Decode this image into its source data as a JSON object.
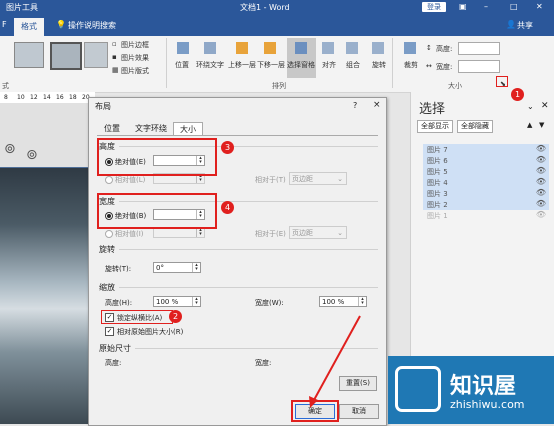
{
  "titlebar": {
    "picture_tools": "图片工具",
    "doc_title": "文档1 - Word",
    "login": "登录",
    "share": "共享"
  },
  "tabs": {
    "file": "F",
    "format": "格式",
    "tell_me": "操作说明搜索"
  },
  "ribbon": {
    "border": "图片边框",
    "effect": "图片效果",
    "layout": "图片版式",
    "position": "位置",
    "wrap_text": "环绕文字",
    "bring_forward": "上移一层",
    "send_backward": "下移一层",
    "selection_pane": "选择窗格",
    "align": "对齐",
    "group": "组合",
    "rotate": "旋转",
    "crop": "裁剪",
    "height_label": "高度:",
    "width_label": "宽度:",
    "arrange_group": "排列",
    "size_group": "大小",
    "styles_group": "式"
  },
  "selection_pane": {
    "title": "选择",
    "show_all": "全部显示",
    "hide_all": "全部隐藏",
    "items": [
      "图片 7",
      "图片 6",
      "图片 5",
      "图片 4",
      "图片 3",
      "图片 2",
      "图片 1"
    ]
  },
  "dialog": {
    "title": "布局",
    "help": "?",
    "close": "×",
    "tabs": [
      "位置",
      "文字环绕",
      "大小"
    ],
    "height": {
      "section": "高度",
      "absolute": "绝对值(E)",
      "relative": "相对值(L)",
      "relative_to": "相对于(T)",
      "relative_to_value": "页边距"
    },
    "width": {
      "section": "宽度",
      "absolute": "绝对值(B)",
      "relative": "相对值(I)",
      "relative_to": "相对于(E)",
      "relative_to_value": "页边距"
    },
    "rotate": {
      "section": "旋转",
      "label": "旋转(T):",
      "value": "0°"
    },
    "scale": {
      "section": "缩放",
      "height_label": "高度(H):",
      "height_value": "100 %",
      "width_label": "宽度(W):",
      "width_value": "100 %",
      "lock_aspect": "锁定纵横比(A)",
      "relative_original": "相对原始图片大小(R)"
    },
    "original": {
      "section": "原始尺寸",
      "height": "高度:",
      "width": "宽度:"
    },
    "reset": "重置(S)",
    "ok": "确定",
    "cancel": "取消"
  },
  "ruler": {
    "ticks": [
      "8",
      "10",
      "12",
      "14",
      "16",
      "18",
      "20"
    ]
  },
  "badges": [
    "1",
    "2",
    "3",
    "4"
  ],
  "watermark": {
    "cn": "知识屋",
    "en": "zhishiwu.com"
  },
  "colors": {
    "accent": "#2b579a",
    "highlight": "#e0201e",
    "selection_row": "#cfe0f5"
  }
}
